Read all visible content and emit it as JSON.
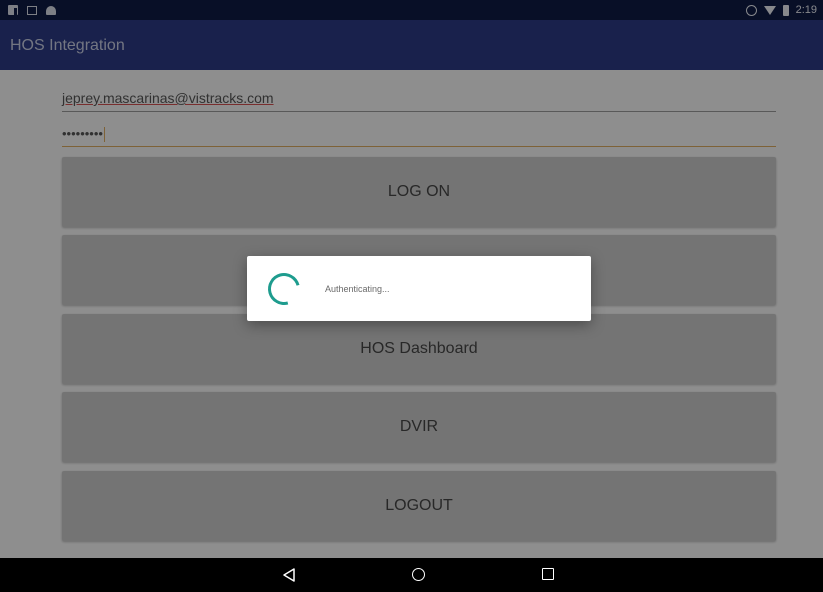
{
  "status_bar": {
    "left_icons": [
      "facebook-icon",
      "image-icon",
      "android-icon"
    ],
    "right_icons": [
      "alarm-icon",
      "wifi-icon",
      "battery-charging-icon"
    ],
    "time": "2:19"
  },
  "app_bar": {
    "title": "HOS Integration"
  },
  "form": {
    "email_value": "jeprey.mascarinas@vistracks.com",
    "password_value": "•••••••••"
  },
  "buttons": {
    "log_on": "LOG ON",
    "hos_dashboard": "HOS Dashboard",
    "dvir": "DVIR",
    "logout": "LOGOUT"
  },
  "dialog": {
    "message": "Authenticating..."
  },
  "colors": {
    "status_bar": "#0e1a44",
    "app_bar": "#2b3a84",
    "spinner": "#1e9c8e",
    "button": "#c9c9c9"
  },
  "nav_bar": {
    "icons": [
      "back-icon",
      "home-icon",
      "recent-apps-icon"
    ]
  }
}
